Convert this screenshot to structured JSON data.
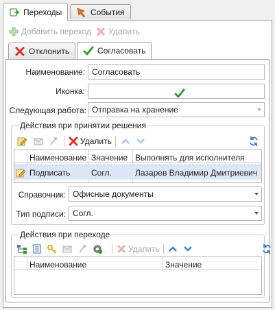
{
  "outer_tabs": [
    {
      "label": "Переходы",
      "icon": "transitions-icon",
      "active": true
    },
    {
      "label": "События",
      "icon": "events-icon",
      "active": false
    }
  ],
  "toolbar": {
    "add_label": "Добавить переход",
    "delete_label": "Удалить"
  },
  "inner_tabs": [
    {
      "label": "Отклонить",
      "icon": "red-x-icon",
      "active": false
    },
    {
      "label": "Согласовать",
      "icon": "green-check-icon",
      "active": true
    }
  ],
  "form": {
    "name_label": "Наименование:",
    "name_value": "Согласовать",
    "icon_label": "Иконка:",
    "next_work_label": "Следующая работа:",
    "next_work_value": "Отправка на хранение"
  },
  "decision_group": {
    "title": "Действия при принятии решения",
    "delete_label": "Удалить",
    "columns": [
      "Наименование",
      "Значение",
      "Выполнять для исполнителя"
    ],
    "rows": [
      {
        "name": "Подписать",
        "value": "Согл.",
        "performer": "Лазарев Владимир Дмитриевич"
      }
    ],
    "directory_label": "Справочник:",
    "directory_value": "Офисные документы",
    "sign_type_label": "Тип подписи:",
    "sign_type_value": "Согл."
  },
  "transition_group": {
    "title": "Действия при переходе",
    "delete_label": "Удалить",
    "columns": [
      "Наименование",
      "Значение"
    ]
  },
  "colors": {
    "selected_row": "#dce8f7",
    "accent_green": "#2e9e2e",
    "accent_red": "#d9342b",
    "chevron_blue": "#3b7fd4"
  }
}
